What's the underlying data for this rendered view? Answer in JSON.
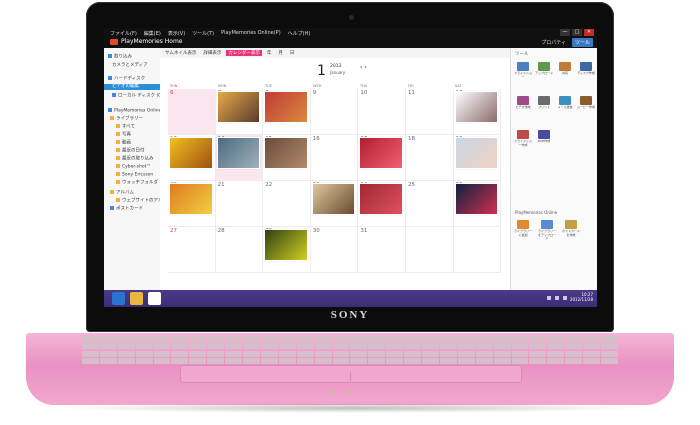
{
  "brand": "SONY",
  "app": {
    "menu": [
      "ファイル(F)",
      "編集(E)",
      "表示(V)",
      "ツール(T)",
      "PlayMemories Online(P)",
      "ヘルプ(H)"
    ],
    "title": "PlayMemories Home",
    "window_controls": [
      "—",
      "□",
      "✕"
    ],
    "properties_label": "プロパティ",
    "tools_button": "ツール"
  },
  "toolbar": {
    "items": [
      "サムネイル表示",
      "詳細表示",
      "カレンダー表示",
      "年",
      "月",
      "日"
    ]
  },
  "sidebar": {
    "items": [
      {
        "label": "取り込み",
        "icon": "import-icon"
      },
      {
        "label": "カメラとメディア",
        "icon": "camera-icon"
      },
      {
        "label": "ハードディスク",
        "icon": "disk-icon"
      },
      {
        "label": "ビデオの編集",
        "icon": "video-icon"
      },
      {
        "label": "ローカル ディスク (C:)",
        "icon": "disk-icon"
      },
      {
        "label": "PlayMemories Online",
        "icon": "cloud-icon"
      },
      {
        "label": "ライブラリー",
        "icon": "library-icon"
      },
      {
        "label": "すべて",
        "icon": "folder-icon"
      },
      {
        "label": "写真",
        "icon": "folder-icon"
      },
      {
        "label": "動画",
        "icon": "folder-icon"
      },
      {
        "label": "最近の日付",
        "icon": "folder-icon"
      },
      {
        "label": "最近の取り込み",
        "icon": "folder-icon"
      },
      {
        "label": "Cyber-shot™",
        "icon": "folder-icon"
      },
      {
        "label": "Sony Ericsson",
        "icon": "folder-icon"
      },
      {
        "label": "ウォッチフォルダ",
        "icon": "folder-icon"
      },
      {
        "label": "アルバム",
        "icon": "album-icon"
      },
      {
        "label": "ウェブサイトのアルバム",
        "icon": "album-icon"
      },
      {
        "label": "ポストカード",
        "icon": "postcard-icon"
      }
    ]
  },
  "calendar": {
    "month_number": "1",
    "year": "2013",
    "month_name": "January",
    "nav": "‹ ›",
    "days_of_week": [
      "SUN",
      "MON",
      "TUE",
      "WED",
      "THU",
      "FRI",
      "SAT"
    ],
    "day_numbers": [
      "6",
      "7",
      "8",
      "9",
      "10",
      "11",
      "12",
      "13",
      "14",
      "15",
      "16",
      "17",
      "18",
      "19",
      "20",
      "21",
      "22",
      "23",
      "24",
      "25",
      "26",
      "27",
      "28",
      "29",
      "30",
      "31"
    ]
  },
  "rightpanel": {
    "header": "ツール",
    "tools": [
      "スライドショー",
      "アップロード",
      "共有",
      "ディスク作成",
      "ビデオ作成",
      "プリント",
      "メール送信",
      "ムービー作成",
      "スライドショー作成",
      "DVD作成"
    ],
    "online_header": "PlayMemories Online",
    "online_tools": [
      "ライブラリーに追加",
      "ライブラリーをアップロード",
      "ポストカードを作成"
    ]
  },
  "taskbar": {
    "time": "10:27",
    "date": "2012/11/28"
  },
  "colors": {
    "accent_pink": "#e8357d",
    "selection_blue": "#2e8fd8",
    "taskbar_purple": "#3b2d75",
    "laptop_pink": "#f2a7cf"
  }
}
